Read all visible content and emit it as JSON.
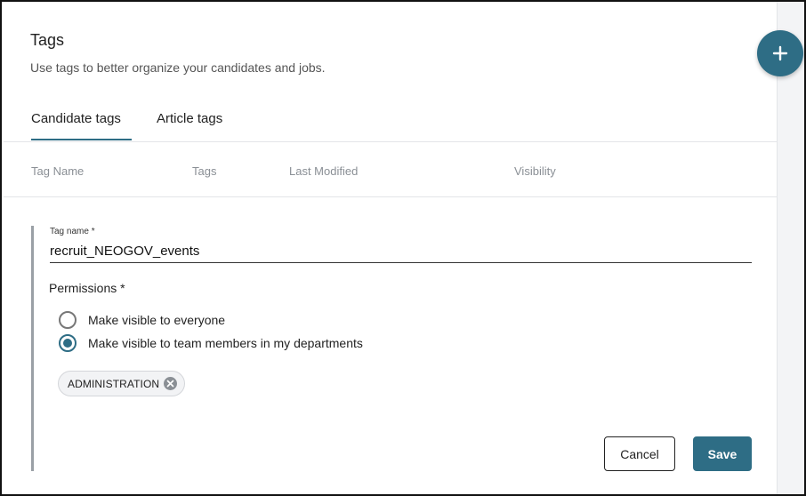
{
  "page": {
    "title": "Tags",
    "subtitle": "Use tags to better organize your candidates and jobs."
  },
  "fab": {
    "icon": "plus-icon"
  },
  "tabs": [
    {
      "label": "Candidate tags",
      "active": true
    },
    {
      "label": "Article tags",
      "active": false
    }
  ],
  "table": {
    "columns": [
      "Tag Name",
      "Tags",
      "Last Modified",
      "Visibility"
    ]
  },
  "form": {
    "tag_name_label": "Tag name *",
    "tag_name_value": "recruit_NEOGOV_events",
    "permissions_label": "Permissions *",
    "options": [
      {
        "label": "Make visible to everyone",
        "selected": false
      },
      {
        "label": "Make visible to team members in my departments",
        "selected": true
      }
    ],
    "departments": [
      {
        "label": "ADMINISTRATION",
        "remove_icon": "close-circle-icon"
      }
    ],
    "cancel_label": "Cancel",
    "save_label": "Save"
  },
  "colors": {
    "accent": "#2e6d85",
    "rail": "#f3f4f6",
    "muted_text": "#8a8f95"
  }
}
